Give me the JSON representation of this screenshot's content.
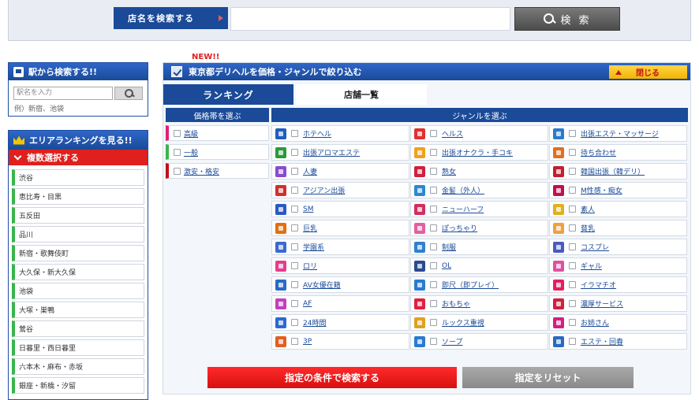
{
  "top_search": {
    "shop_button": "店名を検索する",
    "search_button": "検 索",
    "input_value": ""
  },
  "station": {
    "title": "駅から検索する!!",
    "placeholder": "駅名を入力",
    "example": "例）新宿、池袋"
  },
  "area": {
    "title": "エリアランキングを見る!!",
    "multi_select": "複数選択する",
    "items": [
      "渋谷",
      "恵比寿・目黒",
      "五反田",
      "品川",
      "新宿・歌舞伎町",
      "大久保・新大久保",
      "池袋",
      "大塚・巣鴨",
      "鶯谷",
      "日暮里・西日暮里",
      "六本木・麻布・赤坂",
      "銀座・新橋・汐留"
    ]
  },
  "genre_panel": {
    "new_badge": "NEW!!",
    "title": "東京都デリヘルを価格・ジャンルで絞り込む",
    "close_label": "閉じる",
    "tab_ranking": "ランキング",
    "tab_list": "店舗一覧",
    "price_header": "価格帯を選ぶ",
    "genre_header": "ジャンルを選ぶ",
    "prices": [
      {
        "label": "高級",
        "color": "#e0207a"
      },
      {
        "label": "一般",
        "color": "#38b54a"
      },
      {
        "label": "激安・格安",
        "color": "#c0101a"
      }
    ],
    "genres": [
      {
        "label": "ホテヘル",
        "icon": "hotel-icon",
        "color": "#1f5fbf"
      },
      {
        "label": "ヘルス",
        "icon": "house-icon",
        "color": "#e03030"
      },
      {
        "label": "出張エステ・マッサージ",
        "icon": "car-icon",
        "color": "#2a7ad0"
      },
      {
        "label": "出張アロマエステ",
        "icon": "aroma-icon",
        "color": "#2a9a3a"
      },
      {
        "label": "出張オナクラ・手コキ",
        "icon": "hand-icon",
        "color": "#f0a020"
      },
      {
        "label": "待ち合わせ",
        "icon": "meet-icon",
        "color": "#e07020"
      },
      {
        "label": "人妻",
        "icon": "wife-icon",
        "color": "#8a4ad0"
      },
      {
        "label": "熟女",
        "icon": "lipstick-icon",
        "color": "#d02040"
      },
      {
        "label": "韓国出張（韓デリ）",
        "icon": "korea-flag-icon",
        "color": "#c02030"
      },
      {
        "label": "アジアン出張",
        "icon": "asian-icon",
        "color": "#d03030"
      },
      {
        "label": "金髪（外人）",
        "icon": "blonde-icon",
        "color": "#2a8ad0"
      },
      {
        "label": "M性感・痴女",
        "icon": "whip-icon",
        "color": "#c01050"
      },
      {
        "label": "SM",
        "icon": "sm-icon",
        "color": "#2a5ac0"
      },
      {
        "label": "ニューハーフ",
        "icon": "newhalf-icon",
        "color": "#d03060"
      },
      {
        "label": "素人",
        "icon": "amateur-icon",
        "color": "#e0b020"
      },
      {
        "label": "巨乳",
        "icon": "big-breast-icon",
        "color": "#e07010"
      },
      {
        "label": "ぽっちゃり",
        "icon": "chubby-icon",
        "color": "#e060a0"
      },
      {
        "label": "貧乳",
        "icon": "small-breast-icon",
        "color": "#f0a040"
      },
      {
        "label": "学園系",
        "icon": "pencil-icon",
        "color": "#3a6ad0"
      },
      {
        "label": "制服",
        "icon": "uniform-icon",
        "color": "#3080d0"
      },
      {
        "label": "コスプレ",
        "icon": "cosplay-icon",
        "color": "#4a5ac0"
      },
      {
        "label": "ロリ",
        "icon": "ribbon-icon",
        "color": "#e04090"
      },
      {
        "label": "OL",
        "icon": "office-icon",
        "color": "#2a4a90"
      },
      {
        "label": "ギャル",
        "icon": "gal-icon",
        "color": "#e050a0"
      },
      {
        "label": "AV女優在籍",
        "icon": "film-icon",
        "color": "#2a6ac0"
      },
      {
        "label": "即尺（即プレイ）",
        "icon": "quick-icon",
        "color": "#2a7ad0"
      },
      {
        "label": "イラマチオ",
        "icon": "lips-icon",
        "color": "#e02060"
      },
      {
        "label": "AF",
        "icon": "af-icon",
        "color": "#c040c0"
      },
      {
        "label": "おもちゃ",
        "icon": "toy-icon",
        "color": "#e02040"
      },
      {
        "label": "濃厚サービス",
        "icon": "heart-icon",
        "color": "#d02040"
      },
      {
        "label": "24時間",
        "icon": "clock-icon",
        "color": "#2a6ad0"
      },
      {
        "label": "ルックス重視",
        "icon": "looks-icon",
        "color": "#e0a020"
      },
      {
        "label": "お姉さん",
        "icon": "sister-icon",
        "color": "#d02080"
      },
      {
        "label": "3P",
        "icon": "threesome-icon",
        "color": "#e06020"
      },
      {
        "label": "ソープ",
        "icon": "soap-icon",
        "color": "#2a7ad0"
      },
      {
        "label": "エステ・回春",
        "icon": "drop-icon",
        "color": "#2a6ac0"
      }
    ],
    "submit_label": "指定の条件で検索する",
    "reset_label": "指定をリセット"
  }
}
